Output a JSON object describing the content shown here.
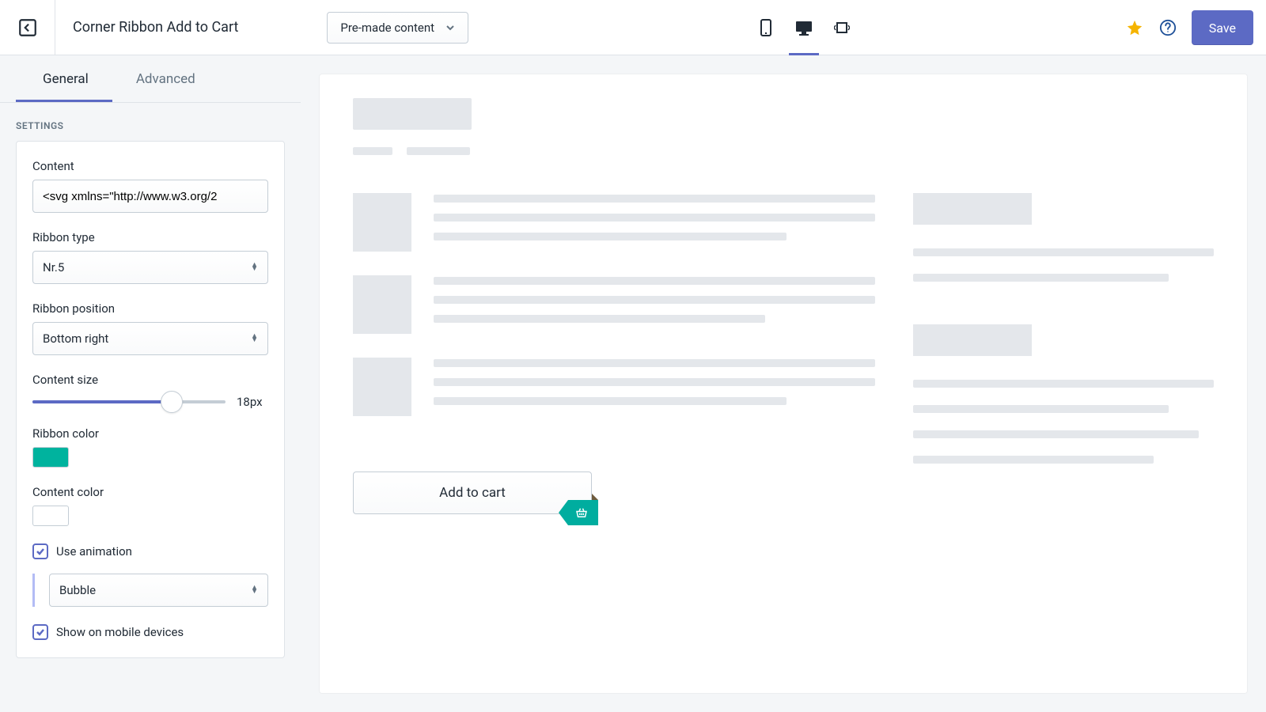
{
  "topbar": {
    "title": "Corner Ribbon Add to Cart",
    "premade_label": "Pre-made content",
    "save_label": "Save"
  },
  "tabs": {
    "general": "General",
    "advanced": "Advanced"
  },
  "settings_heading": "SETTINGS",
  "fields": {
    "content_label": "Content",
    "content_value": "<svg xmlns=\"http://www.w3.org/2",
    "ribbon_type_label": "Ribbon type",
    "ribbon_type_value": "Nr.5",
    "ribbon_position_label": "Ribbon position",
    "ribbon_position_value": "Bottom right",
    "content_size_label": "Content size",
    "content_size_value": "18px",
    "ribbon_color_label": "Ribbon color",
    "ribbon_color_value": "#00b39e",
    "content_color_label": "Content color",
    "content_color_value": "#ffffff",
    "use_animation_label": "Use animation",
    "animation_type_value": "Bubble",
    "show_mobile_label": "Show on mobile devices"
  },
  "preview": {
    "addcart_label": "Add to cart"
  }
}
